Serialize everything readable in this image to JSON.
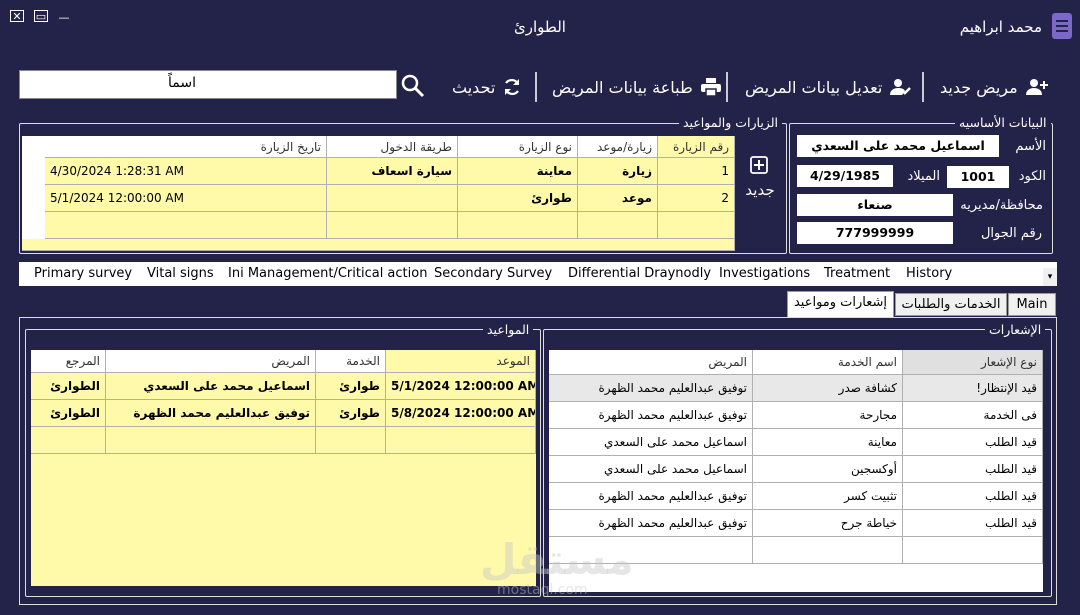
{
  "window": {
    "title": "الطوارئ",
    "user": "محمد ابراهيم",
    "close_symbol": "✕",
    "restore_symbol": "▭",
    "minimize_symbol": "—"
  },
  "toolbar": {
    "new_patient": "مريض جديد",
    "edit_patient": "تعديل بيانات المريض",
    "print_patient": "طباعة بيانات المريض",
    "refresh": "تحديث",
    "search_value": "اسماً"
  },
  "basic_info": {
    "legend": "البيانات الأساسيه",
    "name_label": "الأسم",
    "name": "اسماعيل محمد على السعدي",
    "code_label": "الكود",
    "code": "1001",
    "birth_label": "الميلاد",
    "birth": "4/29/1985",
    "gov_label": "محافظة/مديريه",
    "gov": "صنعاء",
    "phone_label": "رقم الجوال",
    "phone": "777999999"
  },
  "visits": {
    "legend": "الزيارات والمواعيد",
    "new_label": "جديد",
    "columns": [
      "رقم الزيارة",
      "زيارة/موعد",
      "نوع الزيارة",
      "طريقة الدخول",
      "تاريخ الزيارة"
    ],
    "rows": [
      [
        "1",
        "زيارة",
        "معاينة",
        "سيارة اسعاف",
        "4/30/2024 1:28:31 AM"
      ],
      [
        "2",
        "موعد",
        "طوارئ",
        "",
        "5/1/2024 12:00:00 AM"
      ]
    ]
  },
  "tabs": [
    "Primary survey",
    "Vital signs",
    "Ini Management/Critical action",
    "Secondary Survey",
    "Differential Draynodly",
    "Investigations",
    "Treatment",
    "History"
  ],
  "subtabs": [
    "Main",
    "الخدمات والطلبات",
    "إشعارات ومواعيد"
  ],
  "notifications": {
    "legend": "الإشعارات",
    "columns": [
      "نوع الإشعار",
      "اسم الخدمة",
      "المريض"
    ],
    "rows": [
      [
        "!قيد الإنتظار",
        "كشافة صدر",
        "توفيق عبدالعليم محمد الظهرة"
      ],
      [
        "فى الخدمة",
        "مجارحة",
        "توفيق عبدالعليم محمد الظهرة"
      ],
      [
        "قيد الطلب",
        "معاينة",
        "اسماعيل محمد على السعدي"
      ],
      [
        "قيد الطلب",
        "أوكسجين",
        "اسماعيل محمد على السعدي"
      ],
      [
        "قيد الطلب",
        "تثبيت كسر",
        "توفيق عبدالعليم محمد الظهرة"
      ],
      [
        "قيد الطلب",
        "خياطة جرح",
        "توفيق عبدالعليم محمد الظهرة"
      ]
    ]
  },
  "appointments": {
    "legend": "المواعيد",
    "columns": [
      "الموعد",
      "الخدمة",
      "المريض",
      "المرجع"
    ],
    "rows": [
      [
        "5/1/2024 12:00:00 AM",
        "طوارئ",
        "اسماعيل محمد على السعدي",
        "الطوارئ"
      ],
      [
        "5/8/2024 12:00:00 AM",
        "طوارئ",
        "توفيق عبدالعليم محمد الظهرة",
        "الطوارئ"
      ]
    ]
  },
  "watermark": {
    "text": "مستقل",
    "sub": "mostaql.com"
  },
  "colors": {
    "background": "#23234a",
    "selected_row": "#fffaaa",
    "accent_icon": "#7b68c8"
  }
}
